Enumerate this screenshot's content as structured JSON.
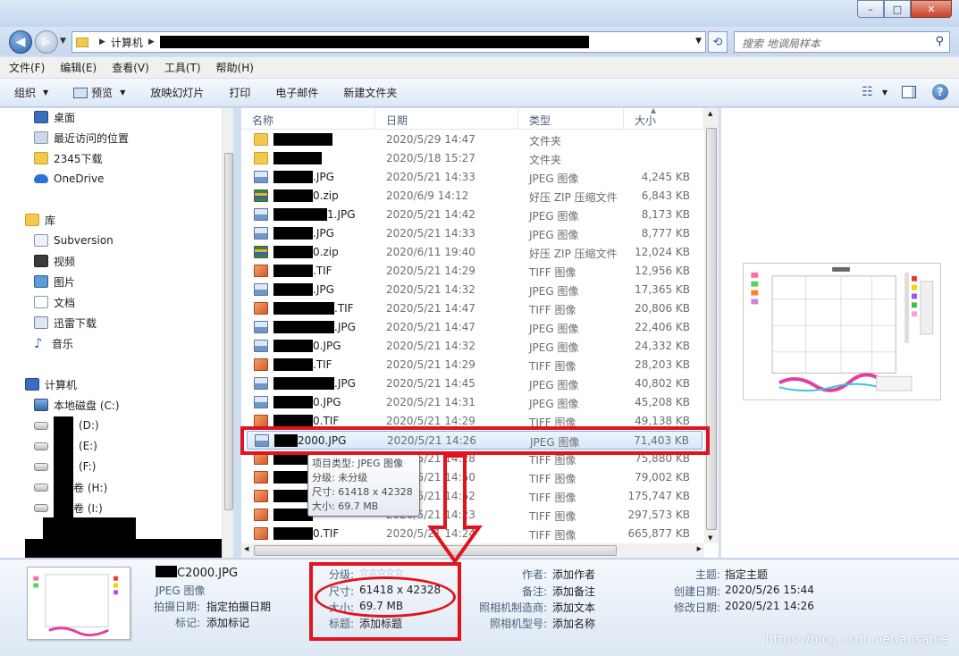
{
  "window": {
    "minimize": "–",
    "maximize": "□",
    "close": "✕"
  },
  "address": {
    "root": "计算机",
    "search_placeholder": "搜索 地调局样本"
  },
  "menu": [
    "文件(F)",
    "编辑(E)",
    "查看(V)",
    "工具(T)",
    "帮助(H)"
  ],
  "toolbar": {
    "organize": "组织",
    "preview": "预览",
    "slideshow": "放映幻灯片",
    "print": "打印",
    "email": "电子邮件",
    "new_folder": "新建文件夹"
  },
  "nav": {
    "favorites": [
      "桌面",
      "最近访问的位置",
      "2345下载",
      "OneDrive"
    ],
    "libraries_title": "库",
    "libraries": [
      "Subversion",
      "视频",
      "图片",
      "文档",
      "迅雷下载",
      "音乐"
    ],
    "computer_title": "计算机",
    "drives": [
      "本地磁盘 (C:)",
      "(D:)",
      "(E:)",
      "(F:)",
      "卷 (H:)",
      "卷 (I:)"
    ]
  },
  "columns": {
    "name": "名称",
    "date": "日期",
    "type": "类型",
    "size": "大小"
  },
  "files": [
    {
      "icon": "folder",
      "suffix": "",
      "redact": 66,
      "date": "2020/5/29 14:47",
      "type": "文件夹",
      "size": ""
    },
    {
      "icon": "folder",
      "suffix": "",
      "redact": 54,
      "date": "2020/5/18 15:27",
      "type": "文件夹",
      "size": ""
    },
    {
      "icon": "jpg",
      "suffix": ".JPG",
      "redact": 44,
      "date": "2020/5/21 14:33",
      "type": "JPEG 图像",
      "size": "4,245 KB"
    },
    {
      "icon": "zip",
      "suffix": "0.zip",
      "redact": 44,
      "date": "2020/6/9 14:12",
      "type": "好压 ZIP 压缩文件",
      "size": "6,843 KB"
    },
    {
      "icon": "jpg",
      "suffix": "1.JPG",
      "redact": 60,
      "date": "2020/5/21 14:42",
      "type": "JPEG 图像",
      "size": "8,173 KB"
    },
    {
      "icon": "jpg",
      "suffix": ".JPG",
      "redact": 44,
      "date": "2020/5/21 14:33",
      "type": "JPEG 图像",
      "size": "8,777 KB"
    },
    {
      "icon": "zip",
      "suffix": "0.zip",
      "redact": 44,
      "date": "2020/6/11 19:40",
      "type": "好压 ZIP 压缩文件",
      "size": "12,024 KB"
    },
    {
      "icon": "tif",
      "suffix": ".TIF",
      "redact": 44,
      "date": "2020/5/21 14:29",
      "type": "TIFF 图像",
      "size": "12,956 KB"
    },
    {
      "icon": "jpg",
      "suffix": ".JPG",
      "redact": 44,
      "date": "2020/5/21 14:32",
      "type": "JPEG 图像",
      "size": "17,365 KB"
    },
    {
      "icon": "tif",
      "suffix": ".TIF",
      "redact": 68,
      "date": "2020/5/21 14:47",
      "type": "TIFF 图像",
      "size": "20,806 KB"
    },
    {
      "icon": "jpg",
      "suffix": ".JPG",
      "redact": 68,
      "date": "2020/5/21 14:47",
      "type": "JPEG 图像",
      "size": "22,406 KB"
    },
    {
      "icon": "jpg",
      "suffix": "0.JPG",
      "redact": 44,
      "date": "2020/5/21 14:32",
      "type": "JPEG 图像",
      "size": "24,332 KB"
    },
    {
      "icon": "tif",
      "suffix": ".TIF",
      "redact": 44,
      "date": "2020/5/21 14:29",
      "type": "TIFF 图像",
      "size": "28,203 KB"
    },
    {
      "icon": "jpg",
      "suffix": ".JPG",
      "redact": 68,
      "date": "2020/5/21 14:45",
      "type": "JPEG 图像",
      "size": "40,802 KB"
    },
    {
      "icon": "jpg",
      "suffix": "0.JPG",
      "redact": 44,
      "date": "2020/5/21 14:31",
      "type": "JPEG 图像",
      "size": "45,208 KB"
    },
    {
      "icon": "tif",
      "suffix": "0.TIF",
      "redact": 44,
      "date": "2020/5/21 14:29",
      "type": "TIFF 图像",
      "size": "49,138 KB"
    },
    {
      "icon": "jpg",
      "suffix": "2000.JPG",
      "redact": 26,
      "date": "2020/5/21 14:26",
      "type": "JPEG 图像",
      "size": "71,403 KB",
      "selected": true
    },
    {
      "icon": "tif",
      "suffix": "",
      "redact": 44,
      "date": "2020/5/21 14:28",
      "type": "TIFF 图像",
      "size": "75,880 KB"
    },
    {
      "icon": "tif",
      "suffix": "",
      "redact": 44,
      "date": "2020/5/21 14:50",
      "type": "TIFF 图像",
      "size": "79,002 KB"
    },
    {
      "icon": "tif",
      "suffix": "",
      "redact": 44,
      "date": "2020/5/21 14:52",
      "type": "TIFF 图像",
      "size": "175,747 KB"
    },
    {
      "icon": "tif",
      "suffix": "",
      "redact": 44,
      "date": "2020/5/21 14:23",
      "type": "TIFF 图像",
      "size": "297,573 KB"
    },
    {
      "icon": "tif",
      "suffix": "0.TIF",
      "redact": 44,
      "date": "2020/5/21 14:24",
      "type": "TIFF 图像",
      "size": "665,877 KB"
    }
  ],
  "tooltip": {
    "type": "项目类型: JPEG 图像",
    "rating": "分级: 未分级",
    "dims": "尺寸: 61418 x 42328",
    "size": "大小: 69.7 MB"
  },
  "details": {
    "filename": "C2000.JPG",
    "filetype": "JPEG 图像",
    "shot_date_label": "拍摄日期:",
    "shot_date_value": "指定拍摄日期",
    "tags_label": "标记:",
    "tags_value": "添加标记",
    "rating_label": "分级:",
    "rating_value": "☆☆☆☆☆",
    "dims_label": "尺寸:",
    "dims_value": "61418 x 42328",
    "size_label": "大小:",
    "size_value": "69.7 MB",
    "title_label": "标题:",
    "title_value": "添加标题",
    "author_label": "作者:",
    "author_value": "添加作者",
    "comment_label": "备注:",
    "comment_value": "添加备注",
    "maker_label": "照相机制造商:",
    "maker_value": "添加文本",
    "model_label": "照相机型号:",
    "model_value": "添加名称",
    "subject_label": "主题:",
    "subject_value": "指定主题",
    "created_label": "创建日期:",
    "created_value": "2020/5/26 15:44",
    "modified_label": "修改日期:",
    "modified_value": "2020/5/21 14:26"
  },
  "watermark": "https://blog.csdn.net/ausable",
  "colors": {
    "annotation_red": "#e0131f",
    "selection_border": "#84acdd"
  }
}
